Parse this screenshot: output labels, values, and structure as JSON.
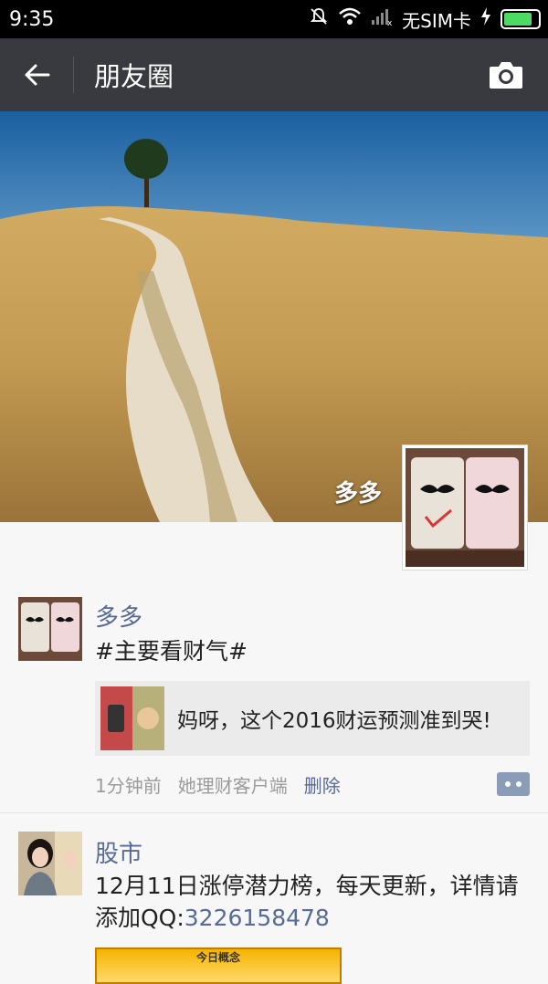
{
  "status_bar": {
    "time": "9:35",
    "carrier": "无SIM卡",
    "icons": [
      "bell-off-icon",
      "wifi-icon",
      "signal-icon",
      "charging-icon",
      "battery-icon"
    ],
    "battery_level": 0.95
  },
  "nav": {
    "title": "朋友圈",
    "back_icon": "arrow-left-icon",
    "camera_icon": "camera-icon"
  },
  "cover": {
    "name": "多多"
  },
  "posts": [
    {
      "name": "多多",
      "text": "#主要看财气#",
      "link_title": "妈呀，这个2016财运预测准到哭!",
      "time": "1分钟前",
      "source": "她理财客户端",
      "delete_label": "删除"
    },
    {
      "name": "股市",
      "text_prefix": "12月11日涨停潜力榜，每天更新，详情请添加QQ:",
      "qq": "3226158478",
      "image_caption": "今日概念"
    }
  ],
  "colors": {
    "navbar": "#393a3f",
    "name_link": "#576b95",
    "battery": "#4cd964"
  }
}
